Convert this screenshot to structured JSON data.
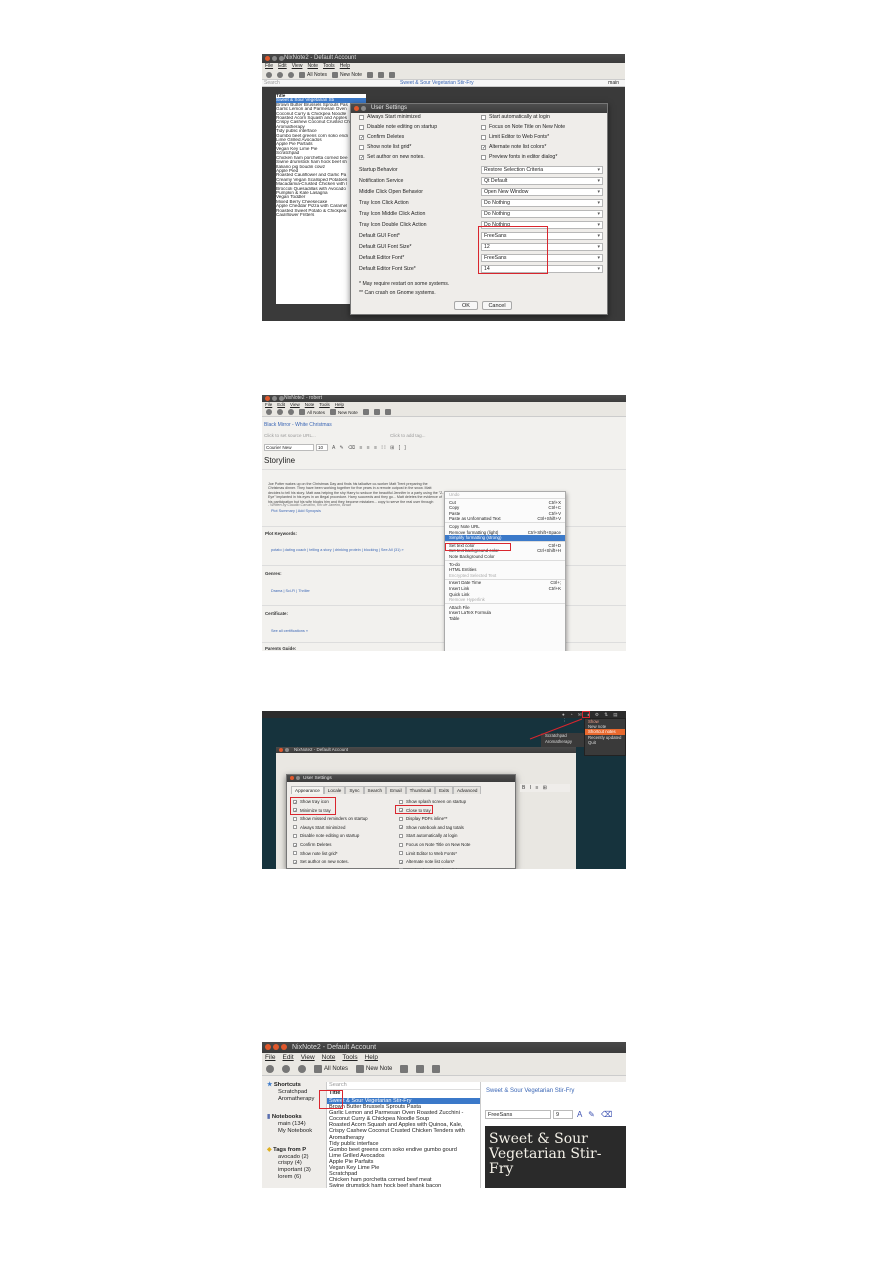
{
  "shot1": {
    "window_title": "NixNote2 - Default Account",
    "menu": [
      "File",
      "Edit",
      "View",
      "Note",
      "Tools",
      "Help"
    ],
    "toolbar": {
      "all_notes": "All Notes",
      "new_note": "New Note"
    },
    "search_placeholder": "Search",
    "note_title": "Sweet & Sour Vegetarian Stir-Fry",
    "notebook": "main",
    "list_header": "Title",
    "list_items": [
      "Sweet & Sour Vegetarian Sti",
      "Brown Butter Brussels Sprouts Pas",
      "Garlic Lemon and Parmesan Oven",
      "Coconut Curry & Chickpea Noodle",
      "Roasted Acorn Squash and Apples",
      "Crispy Cashew Coconut Crusted Ch",
      "Aromatherapy",
      "Tidy public interface",
      "Gumbo beet greens corn soko endi",
      "Lime Grilled Avocados",
      "Apple Pie Parfaits",
      "Vegan Key Lime Pie",
      "Scratchpad",
      "Chicken ham porchetta corned bee",
      "Swine drumstick ham hock beef sh",
      "Italiano pig boudin cowz",
      "Apple Pied",
      "Roasted Cauliflower and Garlic Pa",
      "Creamy Vegan Scalloped Potatoes",
      "Macadamia-Crusted Chicken with l",
      "Broccoli Quesadillas with Avocado",
      "Pumpkin & Kale Lasagna",
      "Vegan Toddler",
      "Mixed Berry Cheesecake",
      "Apple Cheddar Pizza with Caramel",
      "Roasted Sweet Potato & Chickpea",
      "Cauliflower Fritters"
    ],
    "dialog_title": "User Settings",
    "left_opts": [
      {
        "label": "Always Start minimized",
        "checked": false
      },
      {
        "label": "Disable note editing on startup",
        "checked": false
      },
      {
        "label": "Confirm Deletes",
        "checked": true
      },
      {
        "label": "Show note list grid*",
        "checked": false
      },
      {
        "label": "Set author on new notes.",
        "checked": true
      }
    ],
    "right_opts": [
      {
        "label": "Start automatically at login",
        "checked": false
      },
      {
        "label": "Focus on Note Title on New Note",
        "checked": false
      },
      {
        "label": "Limit Editor to Web Fonts*",
        "checked": false
      },
      {
        "label": "Alternate note list colors*",
        "checked": true
      },
      {
        "label": "Preview fonts in editor dialog*",
        "checked": false
      }
    ],
    "settings": [
      {
        "label": "Startup Behavior",
        "value": "Restore Selection Criteria"
      },
      {
        "label": "Notification Service",
        "value": "Qt Default"
      },
      {
        "label": "Middle Click Open Behavior",
        "value": "Open New Window"
      },
      {
        "label": "Tray Icon Click Action",
        "value": "Do Nothing"
      },
      {
        "label": "Tray Icon Middle Click Action",
        "value": "Do Nothing"
      },
      {
        "label": "Tray Icon Double Click Action",
        "value": "Do Nothing"
      },
      {
        "label": "Default GUI Font*",
        "value": "FreeSans"
      },
      {
        "label": "Default GUI Font Size*",
        "value": "12"
      },
      {
        "label": "Default Editor Font*",
        "value": "FreeSans"
      },
      {
        "label": "Default Editor Font Size*",
        "value": "14"
      }
    ],
    "notes": [
      "* May require restart on some systems.",
      "** Can crash on Gnome systems."
    ],
    "ok": "OK",
    "cancel": "Cancel"
  },
  "shot2": {
    "window_title": "NixNote2 - robert",
    "menu": [
      "File",
      "Edit",
      "View",
      "Note",
      "Tools",
      "Help"
    ],
    "toolbar": {
      "all_notes": "All Notes",
      "new_note": "New Note"
    },
    "breadcrumb": "Black Mirror - White Christmas",
    "source_url": "Click to set source URL...",
    "add_tag": "Click to add tag...",
    "font": "Courier New",
    "font_size": "10",
    "heading": "Storyline",
    "body": "Joe Potter wakes up on the Christmas Day and finds his talkative co-worker Matt Trent preparing the Christmas dinner. They have been working together for five years in a remote outpost in the snow. Matt decides to tell his story. Matt was helping the shy Harry to seduce the beautiful Jennifer in a party using the \"Z-Eye\" implanted in his eyes in an illegal procedure. Harry succeeds and they go... Matt deletes the evidence of his participation but his wife blocks him and they become mistaken... copy to serve the real user through torture manipulating time to break any resistance from t...",
    "written_by": "- Written by Claudio Carvalho, Rio de Janeiro, Brazil",
    "plot_links": "Plot Summary | Add Synopsis",
    "sections": [
      "Plot Keywords:",
      "Genres:",
      "Certificate:",
      "Parents Guide:"
    ],
    "keywords": "potato | dating coach | telling a story | drinking protein | blocking | See All (31) »",
    "genres": "Drama | Sci-Fi | Thriller",
    "cert": "See all certifications »",
    "context_menu": [
      {
        "label": "Undo",
        "shortcut": "",
        "state": "dim"
      },
      {
        "label": "Cut",
        "shortcut": "Ctrl+X",
        "state": ""
      },
      {
        "label": "Copy",
        "shortcut": "Ctrl+C",
        "state": ""
      },
      {
        "label": "Paste",
        "shortcut": "Ctrl+V",
        "state": ""
      },
      {
        "label": "Paste as Unformatted Text",
        "shortcut": "Ctrl+Shift+V",
        "state": ""
      },
      {
        "label": "Copy Note URL",
        "shortcut": "",
        "state": ""
      },
      {
        "label": "Remove formatting (light)",
        "shortcut": "Ctrl+Shift+Space",
        "state": ""
      },
      {
        "label": "Simplify formatting (strong)",
        "shortcut": "",
        "state": "hi"
      },
      {
        "label": "Set text color",
        "shortcut": "Ctrl+D",
        "state": ""
      },
      {
        "label": "Set text background color",
        "shortcut": "Ctrl+Shift+H",
        "state": ""
      },
      {
        "label": "Note Background Color",
        "shortcut": "",
        "state": ""
      },
      {
        "label": "To-do",
        "shortcut": "",
        "state": ""
      },
      {
        "label": "HTML Entities",
        "shortcut": "",
        "state": ""
      },
      {
        "label": "Encrypted Selected Text",
        "shortcut": "",
        "state": "dim"
      },
      {
        "label": "Insert Date Time",
        "shortcut": "Ctrl+;",
        "state": ""
      },
      {
        "label": "Insert Link",
        "shortcut": "Ctrl+K",
        "state": ""
      },
      {
        "label": "Quick Link",
        "shortcut": "",
        "state": ""
      },
      {
        "label": "Remove Hyperlink",
        "shortcut": "",
        "state": "dim"
      },
      {
        "label": "Attach File",
        "shortcut": "",
        "state": ""
      },
      {
        "label": "Insert LaTeX Formula",
        "shortcut": "",
        "state": ""
      },
      {
        "label": "Table",
        "shortcut": "",
        "state": ""
      }
    ]
  },
  "shot3": {
    "tray_menu": [
      "Show",
      "New note",
      "Shortcut notes",
      "Recently updated",
      "Quit"
    ],
    "tray_sub": [
      "Scratchpad",
      "Aromatherapy"
    ],
    "window_title": "NixNote2 - Default Account",
    "dialog_title": "User Settings",
    "tabs": [
      "Appearance",
      "Locale",
      "Sync",
      "Search",
      "Email",
      "Thumbnail",
      "Exits",
      "Advanced"
    ],
    "left_opts": [
      {
        "label": "Show tray icon",
        "checked": true
      },
      {
        "label": "Minimize to tray",
        "checked": true
      },
      {
        "label": "Show missed reminders on startup",
        "checked": false
      },
      {
        "label": "Always Start minimized",
        "checked": false
      },
      {
        "label": "Disable note editing on startup",
        "checked": false
      },
      {
        "label": "Confirm Deletes",
        "checked": true
      },
      {
        "label": "Show note list grid*",
        "checked": false
      },
      {
        "label": "Set author on new notes.",
        "checked": true
      }
    ],
    "right_opts": [
      {
        "label": "Show splash screen on startup",
        "checked": false
      },
      {
        "label": "Close to tray",
        "checked": true
      },
      {
        "label": "Display PDFs inline**",
        "checked": false
      },
      {
        "label": "Show notebook and tag totals",
        "checked": true
      },
      {
        "label": "Start automatically at login",
        "checked": false
      },
      {
        "label": "Focus on Note Title on New Note",
        "checked": false
      },
      {
        "label": "Limit Editor to Web Fonts*",
        "checked": false
      },
      {
        "label": "Alternate note list colors*",
        "checked": true
      },
      {
        "label": "Preview fonts in editor dialog*",
        "checked": false
      }
    ]
  },
  "shot4": {
    "window_title": "NixNote2 - Default Account",
    "menu": [
      "File",
      "Edit",
      "View",
      "Note",
      "Tools",
      "Help"
    ],
    "toolbar": {
      "all_notes": "All Notes",
      "new_note": "New Note"
    },
    "shortcuts_label": "Shortcuts",
    "shortcuts": [
      "Scratchpad",
      "Aromatherapy"
    ],
    "notebooks_label": "Notebooks",
    "notebooks": [
      "main (134)",
      "My Notebook"
    ],
    "tags_label": "Tags from P",
    "tags": [
      "avocado (2)",
      "crispy (4)",
      "important (3)",
      "lorem (6)"
    ],
    "search_placeholder": "Search",
    "list_header": "Title",
    "list_items": [
      "Sweet & Sour Vegetarian Stir-Fry",
      "Brown Butter Brussels Sprouts Pasta",
      "Garlic Lemon and Parmesan Oven Roasted Zucchini -",
      "Coconut Curry & Chickpea Noodle Soup",
      "Roasted Acorn Squash and Apples with Quinoa, Kale,",
      "Crispy Cashew Coconut Crusted Chicken Tenders with",
      "Aromatherapy",
      "Tidy public interface",
      "Gumbo beet greens corn soko endive gumbo gourd",
      "Lime Grilled Avocados",
      "Apple Pie Parfaits",
      "Vegan Key Lime Pie",
      "Scratchpad",
      "Chicken ham porchetta corned beef meat",
      "Swine drumstick ham hock beef shank bacon"
    ],
    "note_title": "Sweet & Sour Vegetarian Stir-Fry",
    "font": "FreeSans",
    "font_size": "9",
    "hero_line1": "Sweet & Sour",
    "hero_line2": "Vegetarian Stir-Fry"
  }
}
